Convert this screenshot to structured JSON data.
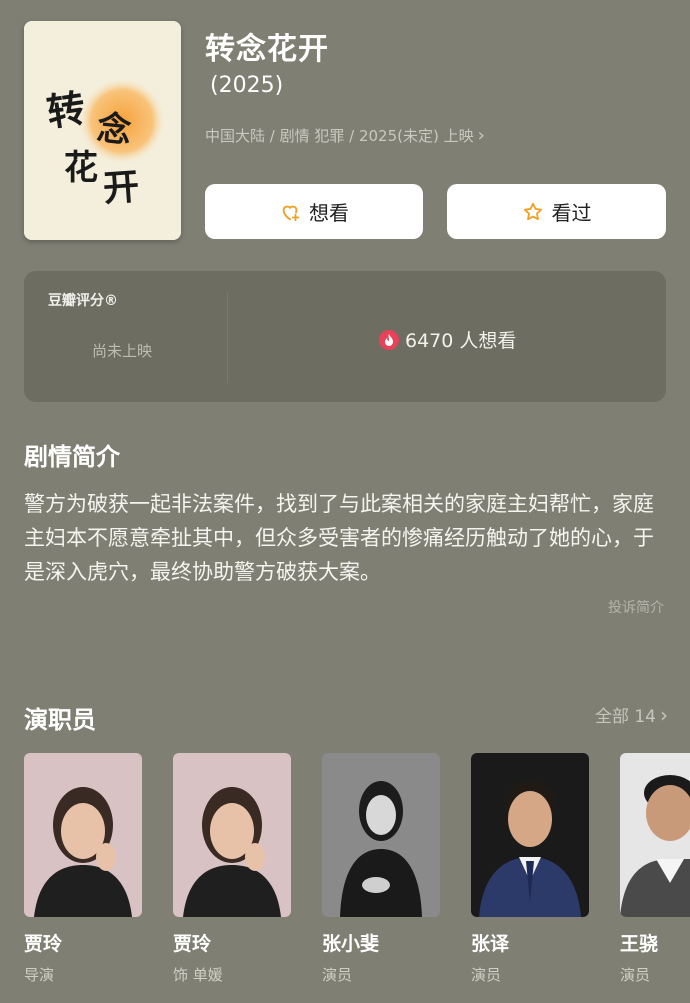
{
  "movie": {
    "title": "转念花开",
    "year": "(2025)",
    "meta": "中国大陆 / 剧情 犯罪 / 2025(未定) 上映",
    "poster_text": "转念花开"
  },
  "actions": {
    "want_label": "想看",
    "seen_label": "看过"
  },
  "rating": {
    "label": "豆瓣评分®",
    "status": "尚未上映",
    "wish_count": "6470 人想看"
  },
  "synopsis": {
    "heading": "剧情简介",
    "text": "警方为破获一起非法案件，找到了与此案相关的家庭主妇帮忙，家庭主妇本不愿意牵扯其中，但众多受害者的惨痛经历触动了她的心，于是深入虎穴，最终协助警方破获大案。",
    "report_label": "投诉简介"
  },
  "cast": {
    "heading": "演职员",
    "all_label": "全部 14",
    "members": [
      {
        "name": "贾玲",
        "role": "导演"
      },
      {
        "name": "贾玲",
        "role": "饰 单媛"
      },
      {
        "name": "张小斐",
        "role": "演员"
      },
      {
        "name": "张译",
        "role": "演员"
      },
      {
        "name": "王骁",
        "role": "演员"
      }
    ]
  },
  "colors": {
    "background": "#7f7f74",
    "card": "#6d6d62",
    "accent_star": "#f0a020",
    "wish_icon": "#e8415a"
  }
}
